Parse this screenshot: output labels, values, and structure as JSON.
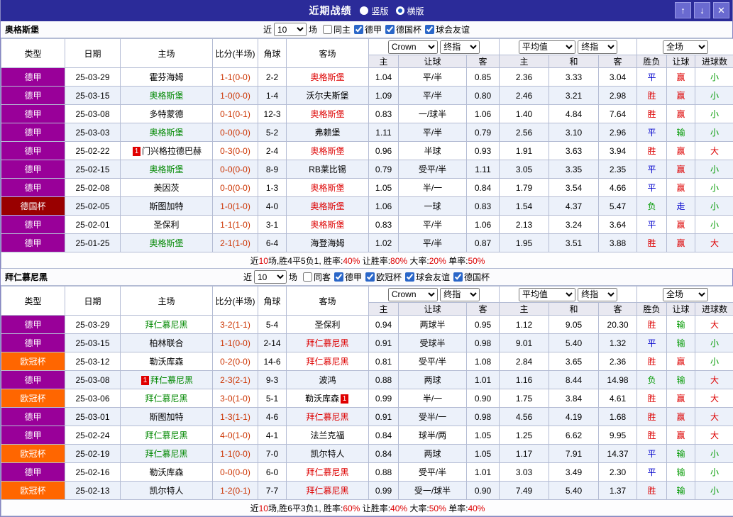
{
  "topbar": {
    "title": "近期战绩",
    "radios": [
      {
        "label": "竖版",
        "selected": false
      },
      {
        "label": "横版",
        "selected": true
      }
    ],
    "up_label": "↑",
    "down_label": "↓",
    "close_label": "✕"
  },
  "columns": {
    "type": "类型",
    "date": "日期",
    "home": "主场",
    "score": "比分(半场)",
    "corner": "角球",
    "away": "客场",
    "ah_home": "主",
    "ah_line": "让球",
    "ah_away": "客",
    "eu_home": "主",
    "eu_draw": "和",
    "eu_away": "客",
    "result": "胜负",
    "handicap": "让球",
    "goals": "进球数"
  },
  "colors": {
    "league": {
      "德甲": "#990099",
      "德国杯": "#990000",
      "欧冠杯": "#ff6600"
    },
    "team": {
      "green": "#008800",
      "red": "#dd0000"
    },
    "word": {
      "胜": "#dd0000",
      "平": "#0000cc",
      "负": "#009900",
      "赢": "#dd0000",
      "走": "#0000cc",
      "输": "#009900",
      "大": "#dd0000",
      "小": "#009900"
    },
    "score": "#cc3300"
  },
  "sections": [
    {
      "team": "奥格斯堡",
      "filter": {
        "near": "近",
        "count": "10",
        "unit": "场",
        "checkboxes": [
          {
            "label": "同主",
            "checked": false
          },
          {
            "label": "德甲",
            "checked": true
          },
          {
            "label": "德国杯",
            "checked": true
          },
          {
            "label": "球会友谊",
            "checked": true
          }
        ]
      },
      "selectors": {
        "book": "Crown",
        "book_time": "终指",
        "avg": "平均值",
        "avg_time": "终指",
        "scope": "全场"
      },
      "rows": [
        {
          "league": "德甲",
          "date": "25-03-29",
          "home": "霍芬海姆",
          "home_color": "",
          "score": "1-1(0-0)",
          "corner": "2-2",
          "away": "奥格斯堡",
          "away_color": "red",
          "ah": [
            "1.04",
            "平/半",
            "0.85"
          ],
          "eu": [
            "2.36",
            "3.33",
            "3.04"
          ],
          "result": "平",
          "handicap": "赢",
          "goal": "小"
        },
        {
          "league": "德甲",
          "date": "25-03-15",
          "home": "奥格斯堡",
          "home_color": "green",
          "score": "1-0(0-0)",
          "corner": "1-4",
          "away": "沃尔夫斯堡",
          "away_color": "",
          "ah": [
            "1.09",
            "平/半",
            "0.80"
          ],
          "eu": [
            "2.46",
            "3.21",
            "2.98"
          ],
          "result": "胜",
          "handicap": "赢",
          "goal": "小"
        },
        {
          "league": "德甲",
          "date": "25-03-08",
          "home": "多特蒙德",
          "home_color": "",
          "score": "0-1(0-1)",
          "corner": "12-3",
          "away": "奥格斯堡",
          "away_color": "red",
          "ah": [
            "0.83",
            "一/球半",
            "1.06"
          ],
          "eu": [
            "1.40",
            "4.84",
            "7.64"
          ],
          "result": "胜",
          "handicap": "赢",
          "goal": "小"
        },
        {
          "league": "德甲",
          "date": "25-03-03",
          "home": "奥格斯堡",
          "home_color": "green",
          "score": "0-0(0-0)",
          "corner": "5-2",
          "away": "弗赖堡",
          "away_color": "",
          "ah": [
            "1.11",
            "平/半",
            "0.79"
          ],
          "eu": [
            "2.56",
            "3.10",
            "2.96"
          ],
          "result": "平",
          "handicap": "输",
          "goal": "小"
        },
        {
          "league": "德甲",
          "date": "25-02-22",
          "home": "门兴格拉德巴赫",
          "home_color": "",
          "home_badge": "1",
          "score": "0-3(0-0)",
          "corner": "2-4",
          "away": "奥格斯堡",
          "away_color": "red",
          "ah": [
            "0.96",
            "半球",
            "0.93"
          ],
          "eu": [
            "1.91",
            "3.63",
            "3.94"
          ],
          "result": "胜",
          "handicap": "赢",
          "goal": "大"
        },
        {
          "league": "德甲",
          "date": "25-02-15",
          "home": "奥格斯堡",
          "home_color": "green",
          "score": "0-0(0-0)",
          "corner": "8-9",
          "away": "RB莱比锡",
          "away_color": "",
          "ah": [
            "0.79",
            "受平/半",
            "1.11"
          ],
          "eu": [
            "3.05",
            "3.35",
            "2.35"
          ],
          "result": "平",
          "handicap": "赢",
          "goal": "小"
        },
        {
          "league": "德甲",
          "date": "25-02-08",
          "home": "美因茨",
          "home_color": "",
          "score": "0-0(0-0)",
          "corner": "1-3",
          "away": "奥格斯堡",
          "away_color": "red",
          "ah": [
            "1.05",
            "半/一",
            "0.84"
          ],
          "eu": [
            "1.79",
            "3.54",
            "4.66"
          ],
          "result": "平",
          "handicap": "赢",
          "goal": "小"
        },
        {
          "league": "德国杯",
          "date": "25-02-05",
          "home": "斯图加特",
          "home_color": "",
          "score": "1-0(1-0)",
          "corner": "4-0",
          "away": "奥格斯堡",
          "away_color": "red",
          "ah": [
            "1.06",
            "一球",
            "0.83"
          ],
          "eu": [
            "1.54",
            "4.37",
            "5.47"
          ],
          "result": "负",
          "handicap": "走",
          "goal": "小"
        },
        {
          "league": "德甲",
          "date": "25-02-01",
          "home": "圣保利",
          "home_color": "",
          "score": "1-1(1-0)",
          "corner": "3-1",
          "away": "奥格斯堡",
          "away_color": "red",
          "ah": [
            "0.83",
            "平/半",
            "1.06"
          ],
          "eu": [
            "2.13",
            "3.24",
            "3.64"
          ],
          "result": "平",
          "handicap": "赢",
          "goal": "小"
        },
        {
          "league": "德甲",
          "date": "25-01-25",
          "home": "奥格斯堡",
          "home_color": "green",
          "score": "2-1(1-0)",
          "corner": "6-4",
          "away": "海登海姆",
          "away_color": "",
          "ah": [
            "1.02",
            "平/半",
            "0.87"
          ],
          "eu": [
            "1.95",
            "3.51",
            "3.88"
          ],
          "result": "胜",
          "handicap": "赢",
          "goal": "大"
        }
      ],
      "summary_segments": [
        {
          "text": "近",
          "color": "#000000"
        },
        {
          "text": "10",
          "color": "#dd0000"
        },
        {
          "text": "场,胜4平5负1, 胜率:",
          "color": "#000000"
        },
        {
          "text": "40%",
          "color": "#dd0000"
        },
        {
          "text": " 让胜率:",
          "color": "#000000"
        },
        {
          "text": "80%",
          "color": "#dd0000"
        },
        {
          "text": " 大率:",
          "color": "#000000"
        },
        {
          "text": "20%",
          "color": "#dd0000"
        },
        {
          "text": " 单率:",
          "color": "#000000"
        },
        {
          "text": "50%",
          "color": "#dd0000"
        }
      ]
    },
    {
      "team": "拜仁慕尼黑",
      "filter": {
        "near": "近",
        "count": "10",
        "unit": "场",
        "checkboxes": [
          {
            "label": "同客",
            "checked": false
          },
          {
            "label": "德甲",
            "checked": true
          },
          {
            "label": "欧冠杯",
            "checked": true
          },
          {
            "label": "球会友谊",
            "checked": true
          },
          {
            "label": "德国杯",
            "checked": true
          }
        ]
      },
      "selectors": {
        "book": "Crown",
        "book_time": "终指",
        "avg": "平均值",
        "avg_time": "终指",
        "scope": "全场"
      },
      "rows": [
        {
          "league": "德甲",
          "date": "25-03-29",
          "home": "拜仁慕尼黑",
          "home_color": "green",
          "score": "3-2(1-1)",
          "corner": "5-4",
          "away": "圣保利",
          "away_color": "",
          "ah": [
            "0.94",
            "两球半",
            "0.95"
          ],
          "eu": [
            "1.12",
            "9.05",
            "20.30"
          ],
          "result": "胜",
          "handicap": "输",
          "goal": "大"
        },
        {
          "league": "德甲",
          "date": "25-03-15",
          "home": "柏林联合",
          "home_color": "",
          "score": "1-1(0-0)",
          "corner": "2-14",
          "away": "拜仁慕尼黑",
          "away_color": "red",
          "ah": [
            "0.91",
            "受球半",
            "0.98"
          ],
          "eu": [
            "9.01",
            "5.40",
            "1.32"
          ],
          "result": "平",
          "handicap": "输",
          "goal": "小"
        },
        {
          "league": "欧冠杯",
          "date": "25-03-12",
          "home": "勒沃库森",
          "home_color": "",
          "score": "0-2(0-0)",
          "corner": "14-6",
          "away": "拜仁慕尼黑",
          "away_color": "red",
          "ah": [
            "0.81",
            "受平/半",
            "1.08"
          ],
          "eu": [
            "2.84",
            "3.65",
            "2.36"
          ],
          "result": "胜",
          "handicap": "赢",
          "goal": "小"
        },
        {
          "league": "德甲",
          "date": "25-03-08",
          "home": "拜仁慕尼黑",
          "home_color": "green",
          "home_badge": "1",
          "score": "2-3(2-1)",
          "corner": "9-3",
          "away": "波鸿",
          "away_color": "",
          "ah": [
            "0.88",
            "两球",
            "1.01"
          ],
          "eu": [
            "1.16",
            "8.44",
            "14.98"
          ],
          "result": "负",
          "handicap": "输",
          "goal": "大"
        },
        {
          "league": "欧冠杯",
          "date": "25-03-06",
          "home": "拜仁慕尼黑",
          "home_color": "green",
          "score": "3-0(1-0)",
          "corner": "5-1",
          "away": "勒沃库森",
          "away_color": "",
          "away_badge": "1",
          "ah": [
            "0.99",
            "半/一",
            "0.90"
          ],
          "eu": [
            "1.75",
            "3.84",
            "4.61"
          ],
          "result": "胜",
          "handicap": "赢",
          "goal": "大"
        },
        {
          "league": "德甲",
          "date": "25-03-01",
          "home": "斯图加特",
          "home_color": "",
          "score": "1-3(1-1)",
          "corner": "4-6",
          "away": "拜仁慕尼黑",
          "away_color": "red",
          "ah": [
            "0.91",
            "受半/一",
            "0.98"
          ],
          "eu": [
            "4.56",
            "4.19",
            "1.68"
          ],
          "result": "胜",
          "handicap": "赢",
          "goal": "大"
        },
        {
          "league": "德甲",
          "date": "25-02-24",
          "home": "拜仁慕尼黑",
          "home_color": "green",
          "score": "4-0(1-0)",
          "corner": "4-1",
          "away": "法兰克福",
          "away_color": "",
          "ah": [
            "0.84",
            "球半/两",
            "1.05"
          ],
          "eu": [
            "1.25",
            "6.62",
            "9.95"
          ],
          "result": "胜",
          "handicap": "赢",
          "goal": "大"
        },
        {
          "league": "欧冠杯",
          "date": "25-02-19",
          "home": "拜仁慕尼黑",
          "home_color": "green",
          "score": "1-1(0-0)",
          "corner": "7-0",
          "away": "凯尔特人",
          "away_color": "",
          "ah": [
            "0.84",
            "两球",
            "1.05"
          ],
          "eu": [
            "1.17",
            "7.91",
            "14.37"
          ],
          "result": "平",
          "handicap": "输",
          "goal": "小"
        },
        {
          "league": "德甲",
          "date": "25-02-16",
          "home": "勒沃库森",
          "home_color": "",
          "score": "0-0(0-0)",
          "corner": "6-0",
          "away": "拜仁慕尼黑",
          "away_color": "red",
          "ah": [
            "0.88",
            "受平/半",
            "1.01"
          ],
          "eu": [
            "3.03",
            "3.49",
            "2.30"
          ],
          "result": "平",
          "handicap": "输",
          "goal": "小"
        },
        {
          "league": "欧冠杯",
          "date": "25-02-13",
          "home": "凯尔特人",
          "home_color": "",
          "score": "1-2(0-1)",
          "corner": "7-7",
          "away": "拜仁慕尼黑",
          "away_color": "red",
          "ah": [
            "0.99",
            "受一/球半",
            "0.90"
          ],
          "eu": [
            "7.49",
            "5.40",
            "1.37"
          ],
          "result": "胜",
          "handicap": "输",
          "goal": "小"
        }
      ],
      "summary_segments": [
        {
          "text": "近",
          "color": "#000000"
        },
        {
          "text": "10",
          "color": "#dd0000"
        },
        {
          "text": "场,胜6平3负1, 胜率:",
          "color": "#000000"
        },
        {
          "text": "60%",
          "color": "#dd0000"
        },
        {
          "text": " 让胜率:",
          "color": "#000000"
        },
        {
          "text": "40%",
          "color": "#dd0000"
        },
        {
          "text": " 大率:",
          "color": "#000000"
        },
        {
          "text": "50%",
          "color": "#dd0000"
        },
        {
          "text": " 单率:",
          "color": "#000000"
        },
        {
          "text": "40%",
          "color": "#dd0000"
        }
      ]
    }
  ]
}
